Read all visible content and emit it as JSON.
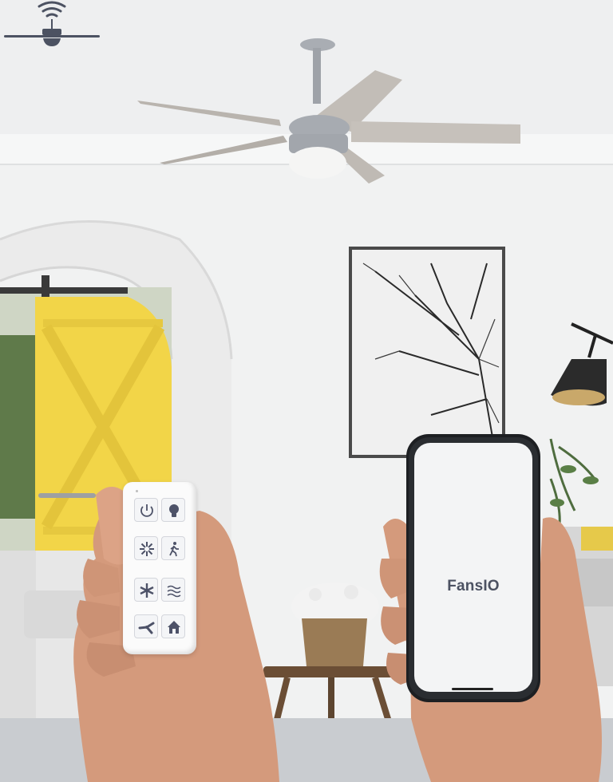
{
  "app": {
    "name": "FansIO"
  },
  "remote": {
    "buttons": [
      {
        "id": "power",
        "icon": "power-icon",
        "glyph": "⏻"
      },
      {
        "id": "light",
        "icon": "light-bulb-icon",
        "glyph": ""
      },
      {
        "id": "fan-speed",
        "icon": "fan-speed-icon",
        "glyph": ""
      },
      {
        "id": "motion",
        "icon": "walking-person-icon",
        "glyph": "🚶"
      },
      {
        "id": "direction",
        "icon": "fan-direction-icon",
        "glyph": ""
      },
      {
        "id": "breeze",
        "icon": "breeze-wave-icon",
        "glyph": "≈"
      },
      {
        "id": "fan",
        "icon": "fan-icon",
        "glyph": ""
      },
      {
        "id": "home",
        "icon": "home-icon",
        "glyph": ""
      }
    ]
  },
  "colors": {
    "accent": "#4c5262",
    "door": "#f2d548",
    "wall": "#f2f3f3"
  }
}
